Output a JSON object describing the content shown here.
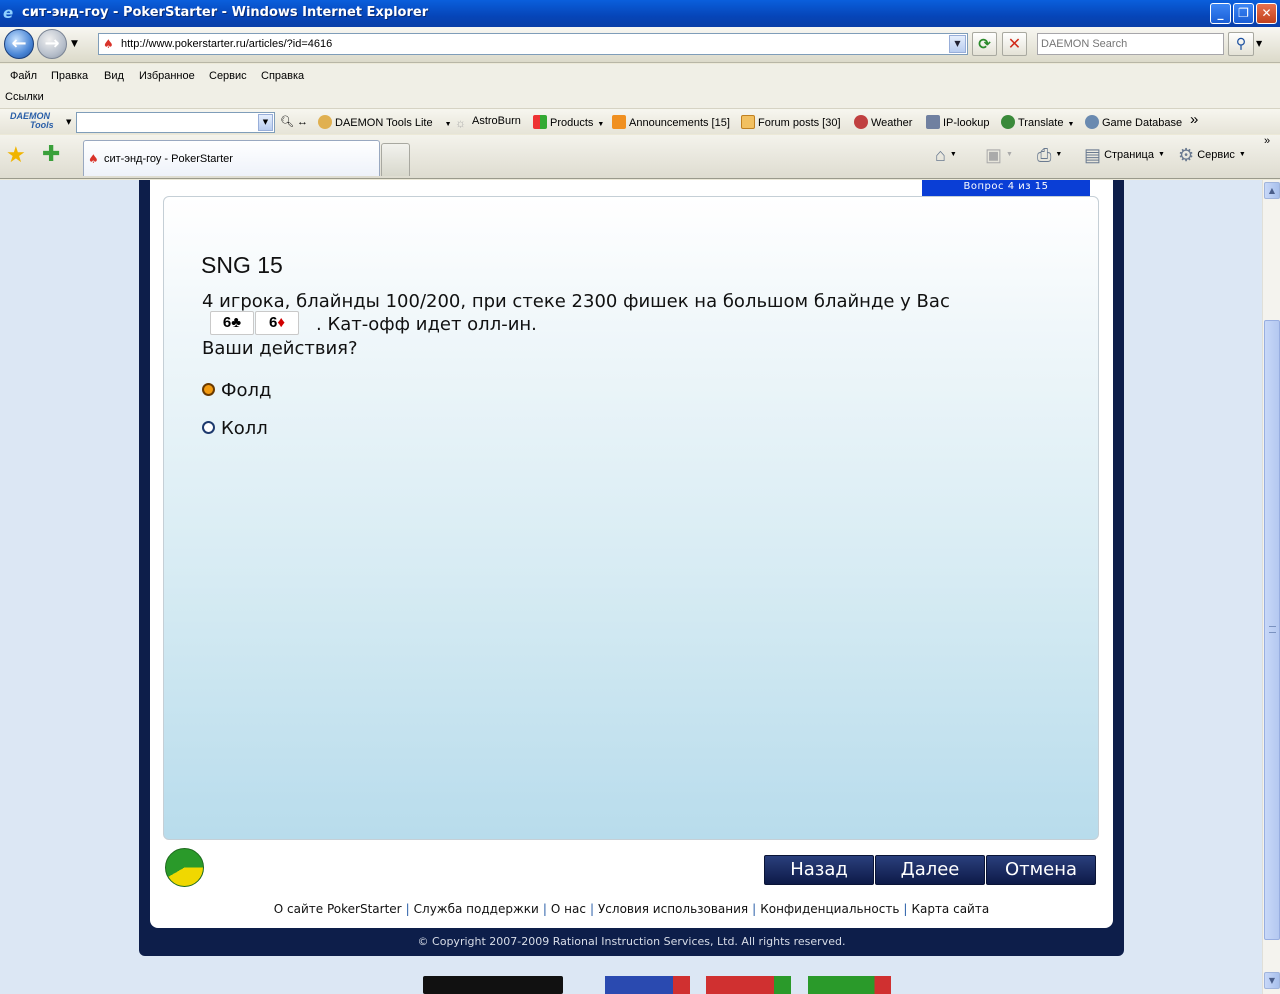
{
  "window": {
    "title": "сит-энд-гоу - PokerStarter - Windows Internet Explorer"
  },
  "address": {
    "url": "http://www.pokerstarter.ru/articles/?id=4616",
    "search_placeholder": "DAEMON Search"
  },
  "menu": {
    "items": [
      "Файл",
      "Правка",
      "Вид",
      "Избранное",
      "Сервис",
      "Справка"
    ],
    "links_label": "Ссылки"
  },
  "toolbar": {
    "daemon_logo_top": "DAEMON",
    "daemon_logo_bottom": "Tools",
    "items": [
      {
        "label": "DAEMON Tools Lite",
        "icon": "daemon-icon"
      },
      {
        "label": "AstroBurn",
        "icon": "astroburn-icon"
      },
      {
        "label": "Products",
        "icon": "products-icon"
      },
      {
        "label": "Announcements [15]",
        "icon": "rss-icon"
      },
      {
        "label": "Forum posts [30]",
        "icon": "forum-icon"
      },
      {
        "label": "Weather",
        "icon": "weather-icon"
      },
      {
        "label": "IP-lookup",
        "icon": "ip-lookup-icon"
      },
      {
        "label": "Translate",
        "icon": "translate-icon"
      },
      {
        "label": "Game Database",
        "icon": "game-database-icon"
      }
    ],
    "more": "»"
  },
  "tabs": {
    "active_label": "сит-энд-гоу - PokerStarter"
  },
  "commands": {
    "page_label": "Страница",
    "tools_label": "Сервис"
  },
  "quiz": {
    "progress": "Вопрос 4 из 15",
    "title": "SNG 15",
    "line1": "4 игрока, блайнды 100/200, при стеке 2300 фишек на большом блайнде у Вас",
    "cards": [
      {
        "rank": "6",
        "suit": "♣",
        "color": "#000000"
      },
      {
        "rank": "6",
        "suit": "♦",
        "color": "#d10000"
      }
    ],
    "line2": ". Кат-офф идет олл-ин.",
    "line3": "Ваши действия?",
    "options": [
      {
        "label": "Фолд",
        "selected": true
      },
      {
        "label": "Колл",
        "selected": false
      }
    ],
    "buttons": {
      "back": "Назад",
      "next": "Далее",
      "cancel": "Отмена"
    }
  },
  "footer": {
    "links": [
      "О сайте PokerStarter",
      "Служба поддержки",
      "О нас",
      "Условия использования",
      "Конфиденциальность",
      "Карта сайта"
    ],
    "copyright": "© Copyright 2007-2009 Rational Instruction Services, Ltd. All rights reserved."
  },
  "colors": {
    "frame": "#0d1e4a",
    "progress_tab": "#0a3ed6",
    "selected_radio": "#f29a10"
  }
}
